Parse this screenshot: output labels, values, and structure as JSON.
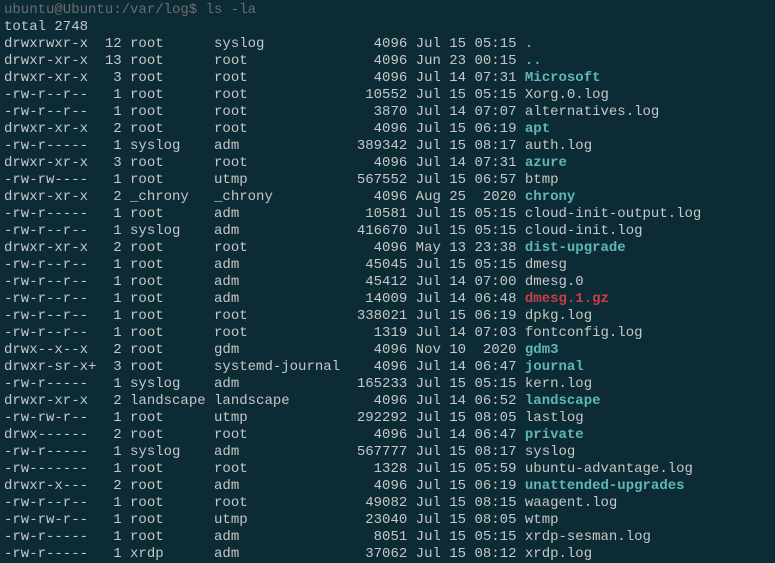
{
  "prompt": "ubuntu@Ubuntu:/var/log$ ",
  "command": "ls -la",
  "total_line": "total 2748",
  "entries": [
    {
      "perms": "drwxrwxr-x",
      "links": "12",
      "owner": "root",
      "group": "syslog",
      "size": "4096",
      "date": "Jul 15 05:15",
      "name": ".",
      "type": "dir"
    },
    {
      "perms": "drwxr-xr-x",
      "links": "13",
      "owner": "root",
      "group": "root",
      "size": "4096",
      "date": "Jun 23 00:15",
      "name": "..",
      "type": "dir"
    },
    {
      "perms": "drwxr-xr-x",
      "links": "3",
      "owner": "root",
      "group": "root",
      "size": "4096",
      "date": "Jul 14 07:31",
      "name": "Microsoft",
      "type": "dir"
    },
    {
      "perms": "-rw-r--r--",
      "links": "1",
      "owner": "root",
      "group": "root",
      "size": "10552",
      "date": "Jul 15 05:15",
      "name": "Xorg.0.log",
      "type": "file"
    },
    {
      "perms": "-rw-r--r--",
      "links": "1",
      "owner": "root",
      "group": "root",
      "size": "3870",
      "date": "Jul 14 07:07",
      "name": "alternatives.log",
      "type": "file"
    },
    {
      "perms": "drwxr-xr-x",
      "links": "2",
      "owner": "root",
      "group": "root",
      "size": "4096",
      "date": "Jul 15 06:19",
      "name": "apt",
      "type": "dir"
    },
    {
      "perms": "-rw-r-----",
      "links": "1",
      "owner": "syslog",
      "group": "adm",
      "size": "389342",
      "date": "Jul 15 08:17",
      "name": "auth.log",
      "type": "file"
    },
    {
      "perms": "drwxr-xr-x",
      "links": "3",
      "owner": "root",
      "group": "root",
      "size": "4096",
      "date": "Jul 14 07:31",
      "name": "azure",
      "type": "dir"
    },
    {
      "perms": "-rw-rw----",
      "links": "1",
      "owner": "root",
      "group": "utmp",
      "size": "567552",
      "date": "Jul 15 06:57",
      "name": "btmp",
      "type": "file"
    },
    {
      "perms": "drwxr-xr-x",
      "links": "2",
      "owner": "_chrony",
      "group": "_chrony",
      "size": "4096",
      "date": "Aug 25  2020",
      "name": "chrony",
      "type": "dir"
    },
    {
      "perms": "-rw-r-----",
      "links": "1",
      "owner": "root",
      "group": "adm",
      "size": "10581",
      "date": "Jul 15 05:15",
      "name": "cloud-init-output.log",
      "type": "file"
    },
    {
      "perms": "-rw-r--r--",
      "links": "1",
      "owner": "syslog",
      "group": "adm",
      "size": "416670",
      "date": "Jul 15 05:15",
      "name": "cloud-init.log",
      "type": "file"
    },
    {
      "perms": "drwxr-xr-x",
      "links": "2",
      "owner": "root",
      "group": "root",
      "size": "4096",
      "date": "May 13 23:38",
      "name": "dist-upgrade",
      "type": "dir"
    },
    {
      "perms": "-rw-r--r--",
      "links": "1",
      "owner": "root",
      "group": "adm",
      "size": "45045",
      "date": "Jul 15 05:15",
      "name": "dmesg",
      "type": "file"
    },
    {
      "perms": "-rw-r--r--",
      "links": "1",
      "owner": "root",
      "group": "adm",
      "size": "45412",
      "date": "Jul 14 07:00",
      "name": "dmesg.0",
      "type": "file"
    },
    {
      "perms": "-rw-r--r--",
      "links": "1",
      "owner": "root",
      "group": "adm",
      "size": "14009",
      "date": "Jul 14 06:48",
      "name": "dmesg.1.gz",
      "type": "gz"
    },
    {
      "perms": "-rw-r--r--",
      "links": "1",
      "owner": "root",
      "group": "root",
      "size": "338021",
      "date": "Jul 15 06:19",
      "name": "dpkg.log",
      "type": "file"
    },
    {
      "perms": "-rw-r--r--",
      "links": "1",
      "owner": "root",
      "group": "root",
      "size": "1319",
      "date": "Jul 14 07:03",
      "name": "fontconfig.log",
      "type": "file"
    },
    {
      "perms": "drwx--x--x",
      "links": "2",
      "owner": "root",
      "group": "gdm",
      "size": "4096",
      "date": "Nov 10  2020",
      "name": "gdm3",
      "type": "dir"
    },
    {
      "perms": "drwxr-sr-x+",
      "links": "3",
      "owner": "root",
      "group": "systemd-journal",
      "size": "4096",
      "date": "Jul 14 06:47",
      "name": "journal",
      "type": "dir"
    },
    {
      "perms": "-rw-r-----",
      "links": "1",
      "owner": "syslog",
      "group": "adm",
      "size": "165233",
      "date": "Jul 15 05:15",
      "name": "kern.log",
      "type": "file"
    },
    {
      "perms": "drwxr-xr-x",
      "links": "2",
      "owner": "landscape",
      "group": "landscape",
      "size": "4096",
      "date": "Jul 14 06:52",
      "name": "landscape",
      "type": "dir"
    },
    {
      "perms": "-rw-rw-r--",
      "links": "1",
      "owner": "root",
      "group": "utmp",
      "size": "292292",
      "date": "Jul 15 08:05",
      "name": "lastlog",
      "type": "file"
    },
    {
      "perms": "drwx------",
      "links": "2",
      "owner": "root",
      "group": "root",
      "size": "4096",
      "date": "Jul 14 06:47",
      "name": "private",
      "type": "dir"
    },
    {
      "perms": "-rw-r-----",
      "links": "1",
      "owner": "syslog",
      "group": "adm",
      "size": "567777",
      "date": "Jul 15 08:17",
      "name": "syslog",
      "type": "file"
    },
    {
      "perms": "-rw-------",
      "links": "1",
      "owner": "root",
      "group": "root",
      "size": "1328",
      "date": "Jul 15 05:59",
      "name": "ubuntu-advantage.log",
      "type": "file"
    },
    {
      "perms": "drwxr-x---",
      "links": "2",
      "owner": "root",
      "group": "adm",
      "size": "4096",
      "date": "Jul 15 06:19",
      "name": "unattended-upgrades",
      "type": "dir"
    },
    {
      "perms": "-rw-r--r--",
      "links": "1",
      "owner": "root",
      "group": "root",
      "size": "49082",
      "date": "Jul 15 08:15",
      "name": "waagent.log",
      "type": "file"
    },
    {
      "perms": "-rw-rw-r--",
      "links": "1",
      "owner": "root",
      "group": "utmp",
      "size": "23040",
      "date": "Jul 15 08:05",
      "name": "wtmp",
      "type": "file"
    },
    {
      "perms": "-rw-r-----",
      "links": "1",
      "owner": "root",
      "group": "adm",
      "size": "8051",
      "date": "Jul 15 05:15",
      "name": "xrdp-sesman.log",
      "type": "file"
    },
    {
      "perms": "-rw-r-----",
      "links": "1",
      "owner": "xrdp",
      "group": "adm",
      "size": "37062",
      "date": "Jul 15 08:12",
      "name": "xrdp.log",
      "type": "file"
    }
  ]
}
